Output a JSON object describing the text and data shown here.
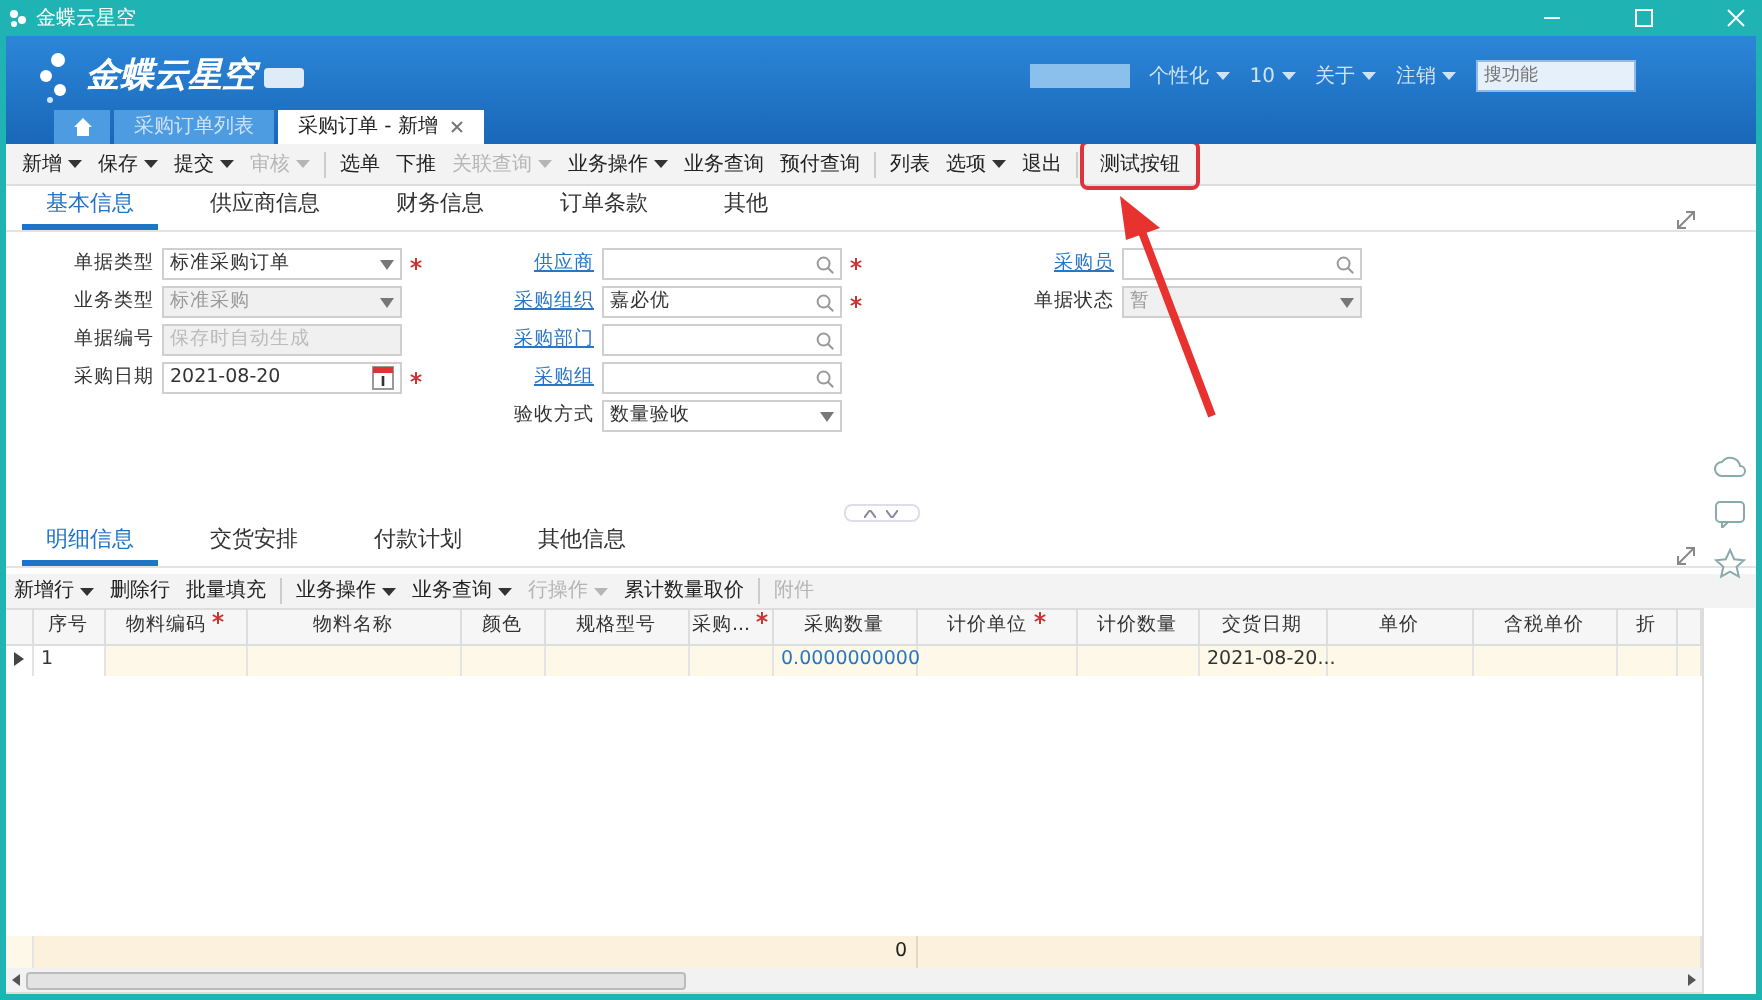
{
  "window": {
    "title": "金蝶云星空"
  },
  "header": {
    "logo": "金蝶云星空",
    "menus": [
      {
        "label": "个性化"
      },
      {
        "label": "10"
      },
      {
        "label": "关于"
      },
      {
        "label": "注销"
      }
    ],
    "search": {
      "placeholder": "搜功能"
    }
  },
  "page_tabs": [
    {
      "kind": "home",
      "selected": false
    },
    {
      "kind": "tab",
      "label": "采购订单列表",
      "selected": false,
      "closable": false
    },
    {
      "kind": "tab",
      "label": "采购订单 - 新增",
      "selected": true,
      "closable": true
    }
  ],
  "toolbar": [
    {
      "kind": "button",
      "label": "新增",
      "dropdown": true,
      "disabled": false,
      "highlighted": false
    },
    {
      "kind": "button",
      "label": "保存",
      "dropdown": true,
      "disabled": false,
      "highlighted": false
    },
    {
      "kind": "button",
      "label": "提交",
      "dropdown": true,
      "disabled": false,
      "highlighted": false
    },
    {
      "kind": "button",
      "label": "审核",
      "dropdown": true,
      "disabled": true,
      "highlighted": false
    },
    {
      "kind": "separator"
    },
    {
      "kind": "button",
      "label": "选单",
      "dropdown": false,
      "disabled": false,
      "highlighted": false
    },
    {
      "kind": "button",
      "label": "下推",
      "dropdown": false,
      "disabled": false,
      "highlighted": false
    },
    {
      "kind": "button",
      "label": "关联查询",
      "dropdown": true,
      "disabled": true,
      "highlighted": false
    },
    {
      "kind": "button",
      "label": "业务操作",
      "dropdown": true,
      "disabled": false,
      "highlighted": false
    },
    {
      "kind": "button",
      "label": "业务查询",
      "dropdown": false,
      "disabled": false,
      "highlighted": false
    },
    {
      "kind": "button",
      "label": "预付查询",
      "dropdown": false,
      "disabled": false,
      "highlighted": false
    },
    {
      "kind": "separator"
    },
    {
      "kind": "button",
      "label": "列表",
      "dropdown": false,
      "disabled": false,
      "highlighted": false
    },
    {
      "kind": "button",
      "label": "选项",
      "dropdown": true,
      "disabled": false,
      "highlighted": false
    },
    {
      "kind": "button",
      "label": "退出",
      "dropdown": false,
      "disabled": false,
      "highlighted": false
    },
    {
      "kind": "separator"
    },
    {
      "kind": "button",
      "label": "测试按钮",
      "dropdown": false,
      "disabled": false,
      "highlighted": true
    }
  ],
  "form_tabs": [
    {
      "label": "基本信息",
      "selected": true
    },
    {
      "label": "供应商信息",
      "selected": false
    },
    {
      "label": "财务信息",
      "selected": false
    },
    {
      "label": "订单条款",
      "selected": false
    },
    {
      "label": "其他",
      "selected": false
    }
  ],
  "form_columns": [
    [
      {
        "label": "单据类型",
        "link": false,
        "kind": "select",
        "value": "标准采购订单",
        "required": true,
        "disabled": false
      },
      {
        "label": "业务类型",
        "link": false,
        "kind": "select",
        "value": "标准采购",
        "required": false,
        "disabled": true
      },
      {
        "label": "单据编号",
        "link": false,
        "kind": "text",
        "placeholder": "保存时自动生成",
        "required": false,
        "disabled": true
      },
      {
        "label": "采购日期",
        "link": false,
        "kind": "date",
        "value": "2021-08-20",
        "required": true,
        "disabled": false
      }
    ],
    [
      {
        "label": "供应商",
        "link": true,
        "kind": "lookup",
        "required": true,
        "disabled": false
      },
      {
        "label": "采购组织",
        "link": true,
        "kind": "lookup",
        "value": "嘉必优",
        "required": true,
        "disabled": false
      },
      {
        "label": "采购部门",
        "link": true,
        "kind": "lookup",
        "required": false,
        "disabled": false
      },
      {
        "label": "采购组",
        "link": true,
        "kind": "lookup",
        "required": false,
        "disabled": false
      },
      {
        "label": "验收方式",
        "link": false,
        "kind": "select",
        "value": "数量验收",
        "required": false,
        "disabled": false
      }
    ],
    [
      {
        "label": "采购员",
        "link": true,
        "kind": "lookup",
        "required": false,
        "disabled": false
      },
      {
        "label": "单据状态",
        "link": false,
        "kind": "select",
        "value": "暂",
        "required": false,
        "disabled": true
      }
    ]
  ],
  "detail_tabs": [
    {
      "label": "明细信息",
      "selected": true
    },
    {
      "label": "交货安排",
      "selected": false
    },
    {
      "label": "付款计划",
      "selected": false
    },
    {
      "label": "其他信息",
      "selected": false
    }
  ],
  "detail_toolbar": [
    {
      "kind": "button",
      "label": "新增行",
      "dropdown": true,
      "disabled": false
    },
    {
      "kind": "button",
      "label": "删除行",
      "dropdown": false,
      "disabled": false
    },
    {
      "kind": "button",
      "label": "批量填充",
      "dropdown": false,
      "disabled": false
    },
    {
      "kind": "separator"
    },
    {
      "kind": "button",
      "label": "业务操作",
      "dropdown": true,
      "disabled": false
    },
    {
      "kind": "button",
      "label": "业务查询",
      "dropdown": true,
      "disabled": false
    },
    {
      "kind": "button",
      "label": "行操作",
      "dropdown": true,
      "disabled": true
    },
    {
      "kind": "button",
      "label": "累计数量取价",
      "dropdown": false,
      "disabled": false
    },
    {
      "kind": "separator"
    },
    {
      "kind": "button",
      "label": "附件",
      "dropdown": false,
      "disabled": true
    }
  ],
  "grid": {
    "columns": [
      {
        "label": "序号",
        "required": false
      },
      {
        "label": "物料编码",
        "required": true
      },
      {
        "label": "物料名称",
        "required": false
      },
      {
        "label": "颜色",
        "required": false
      },
      {
        "label": "规格型号",
        "required": false
      },
      {
        "label": "采购...",
        "required": true
      },
      {
        "label": "采购数量",
        "required": false
      },
      {
        "label": "计价单位",
        "required": true
      },
      {
        "label": "计价数量",
        "required": false
      },
      {
        "label": "交货日期",
        "required": false
      },
      {
        "label": "单价",
        "required": false
      },
      {
        "label": "含税单价",
        "required": false
      },
      {
        "label": "折",
        "required": false
      }
    ],
    "rows": [
      {
        "selected": true,
        "number": "1",
        "quantity": "0.0000000000",
        "delivery_date": "2021-08-20..."
      }
    ],
    "total_quantity": "0"
  },
  "annotation": {
    "kind": "arrow"
  }
}
